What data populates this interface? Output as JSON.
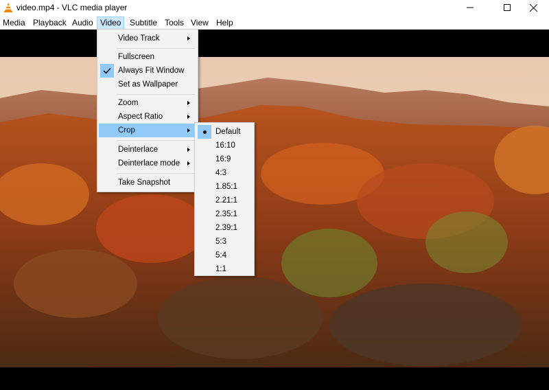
{
  "window": {
    "title": "video.mp4 - VLC media player",
    "app_icon": "vlc-cone-icon"
  },
  "menubar": {
    "items": [
      "Media",
      "Playback",
      "Audio",
      "Video",
      "Subtitle",
      "Tools",
      "View",
      "Help"
    ],
    "active": "Video"
  },
  "video_menu": {
    "items": [
      {
        "label": "Video Track",
        "submenu": true
      },
      {
        "label": "Fullscreen"
      },
      {
        "label": "Always Fit Window",
        "checked": true
      },
      {
        "label": "Set as Wallpaper"
      },
      {
        "label": "Zoom",
        "submenu": true
      },
      {
        "label": "Aspect Ratio",
        "submenu": true
      },
      {
        "label": "Crop",
        "submenu": true,
        "highlighted": true
      },
      {
        "label": "Deinterlace",
        "submenu": true
      },
      {
        "label": "Deinterlace mode",
        "submenu": true
      },
      {
        "label": "Take Snapshot"
      }
    ]
  },
  "crop_menu": {
    "items": [
      "Default",
      "16:10",
      "16:9",
      "4:3",
      "1.85:1",
      "2.21:1",
      "2.35:1",
      "2.39:1",
      "5:3",
      "5:4",
      "1:1"
    ],
    "selected": "Default"
  },
  "colors": {
    "highlight": "#91c9f7",
    "menu_bg": "#f2f2f2",
    "menubar_active": "#cce8ff",
    "vlc_orange": "#f08a00"
  }
}
